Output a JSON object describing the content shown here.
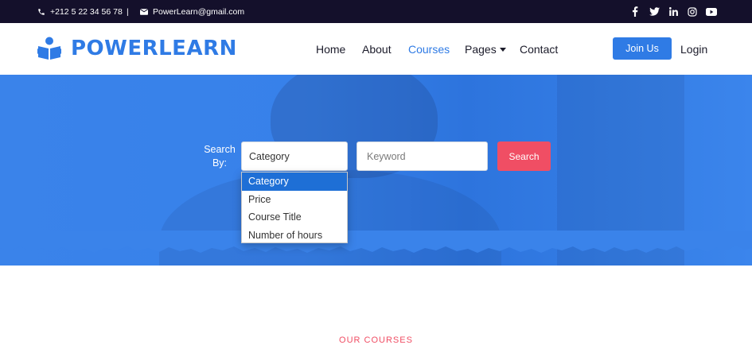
{
  "topbar": {
    "phone": "+212 5 22 34 56 78",
    "separator": "|",
    "email": "PowerLearn@gmail.com",
    "socials": [
      "facebook-icon",
      "twitter-icon",
      "linkedin-icon",
      "instagram-icon",
      "youtube-icon"
    ]
  },
  "brand": {
    "name": "POWERLEARN"
  },
  "nav": {
    "items": [
      "Home",
      "About",
      "Courses",
      "Pages",
      "Contact"
    ],
    "active": "Courses",
    "join_label": "Join Us",
    "login_label": "Login"
  },
  "search": {
    "label": "Search By:",
    "selected": "Category",
    "options": [
      "Category",
      "Price",
      "Course Title",
      "Number of hours"
    ],
    "keyword_placeholder": "Keyword",
    "button_label": "Search"
  },
  "section": {
    "tag": "OUR COURSES"
  },
  "colors": {
    "brand": "#2f7be5",
    "accent": "#f04e64",
    "topbar": "#14102b"
  }
}
